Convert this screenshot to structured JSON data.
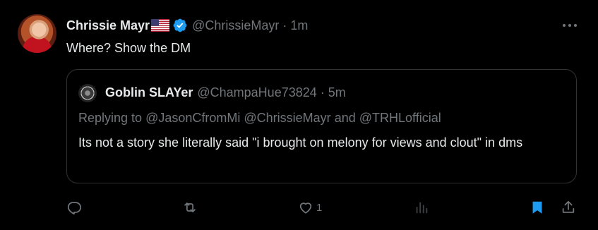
{
  "tweet": {
    "author_name": "Chrissie Mayr",
    "handle": "@ChrissieMayr",
    "separator": "·",
    "time": "1m",
    "text": "Where? Show the DM"
  },
  "quote": {
    "author_name": "Goblin SLAYer",
    "handle": "@ChampaHue73824",
    "separator": "·",
    "time": "5m",
    "reply_prefix": "Replying to",
    "mention_1": "@JasonCfromMi",
    "mention_2": "@ChrissieMayr",
    "conjunction": "and",
    "mention_3": "@TRHLofficial",
    "text": "Its not a story she literally said \"i brought on melony for views and clout\" in dms"
  },
  "actions": {
    "likes_count": "1"
  },
  "colors": {
    "background": "#000000",
    "primary_text": "#e7e9ea",
    "secondary_text": "#71767b",
    "border": "#2f3336",
    "accent": "#1d9bf0"
  },
  "icons": [
    "more-icon",
    "verified-icon",
    "us-flag-icon",
    "reply-icon",
    "retweet-icon",
    "like-icon",
    "views-icon",
    "bookmark-icon",
    "share-icon"
  ]
}
